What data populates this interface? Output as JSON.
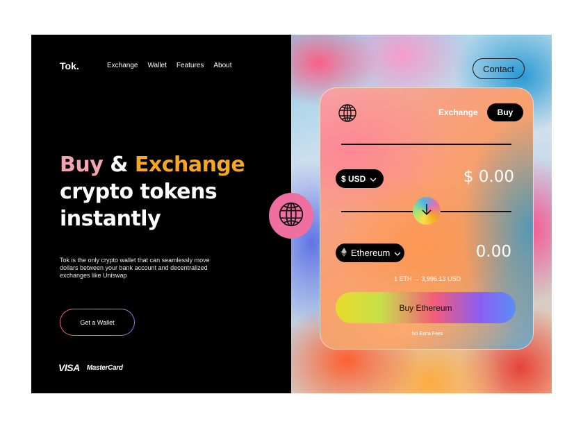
{
  "header": {
    "logo": "Tok.",
    "nav": [
      "Exchange",
      "Wallet",
      "Features",
      "About"
    ],
    "contact_label": "Contact"
  },
  "hero": {
    "title_word1": "Buy",
    "title_amp": " & ",
    "title_word2": "Exchange",
    "title_line2": "crypto tokens",
    "title_line3": "instantly",
    "description": "Tok is the only crypto wallet that can seamlessly move dollars between your bank account and decentralized exchanges like Uniswap",
    "cta_label": "Get a Wallet"
  },
  "brands": {
    "visa": "VISA",
    "mastercard": "MasterCard"
  },
  "widget": {
    "tab_exchange": "Exchange",
    "tab_buy": "Buy",
    "from_currency": "$ USD",
    "from_amount": "$ 0.00",
    "to_currency": "Ethereum",
    "to_amount": "0.00",
    "rate": "1 ETH → 3,996.13 USD",
    "buy_label": "Buy Ethereum",
    "fees": "No Extra Fees"
  },
  "colors": {
    "pink_accent": "#f4a3b0",
    "orange_accent": "#f5a623",
    "globe_badge": "#ee6fa0"
  },
  "icons": [
    "globe-icon",
    "chevron-down-icon",
    "ethereum-icon",
    "arrow-down-icon"
  ]
}
